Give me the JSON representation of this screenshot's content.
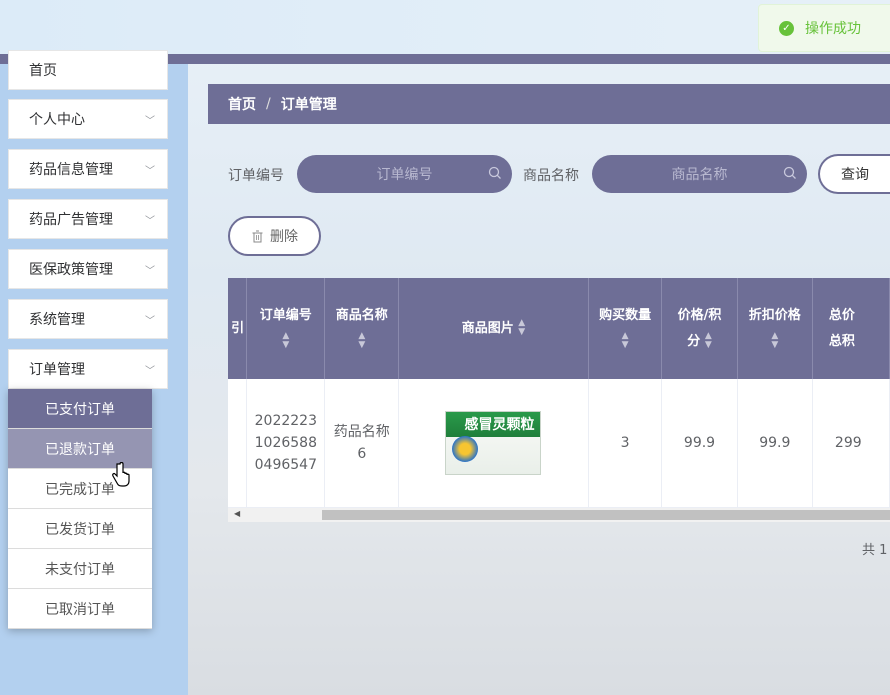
{
  "toast": {
    "text": "操作成功"
  },
  "sidebar": {
    "items": [
      {
        "label": "首页"
      },
      {
        "label": "个人中心"
      },
      {
        "label": "药品信息管理"
      },
      {
        "label": "药品广告管理"
      },
      {
        "label": "医保政策管理"
      },
      {
        "label": "系统管理"
      },
      {
        "label": "订单管理"
      }
    ],
    "submenu": [
      {
        "label": "已支付订单"
      },
      {
        "label": "已退款订单"
      },
      {
        "label": "已完成订单"
      },
      {
        "label": "已发货订单"
      },
      {
        "label": "未支付订单"
      },
      {
        "label": "已取消订单"
      }
    ]
  },
  "breadcrumb": {
    "home": "首页",
    "separator": "/",
    "current": "订单管理"
  },
  "search": {
    "order_label": "订单编号",
    "order_placeholder": "订单编号",
    "product_label": "商品名称",
    "product_placeholder": "商品名称",
    "query_button": "查询",
    "delete_button": "删除"
  },
  "table": {
    "headers": {
      "partial": "引",
      "order_no": "订单编号",
      "product_name": "商品名称",
      "product_image": "商品图片",
      "quantity": "购买数量",
      "price_line1": "价格/积",
      "price_line2": "分",
      "discount": "折扣价格",
      "total_line1": "总价",
      "total_line2": "总积"
    },
    "row": {
      "order_no_l1": "2022223",
      "order_no_l2": "1026588",
      "order_no_l3": "0496547",
      "product_name_l1": "药品名称",
      "product_name_l2": "6",
      "product_box_title": "感冒灵颗粒",
      "quantity": "3",
      "price": "99.9",
      "discount": "99.9",
      "total": "299"
    }
  },
  "pagination": {
    "total": "共 1"
  },
  "colors": {
    "accent": "#6e6e96",
    "sidebar": "#b3d0ef",
    "success": "#67c23a"
  }
}
